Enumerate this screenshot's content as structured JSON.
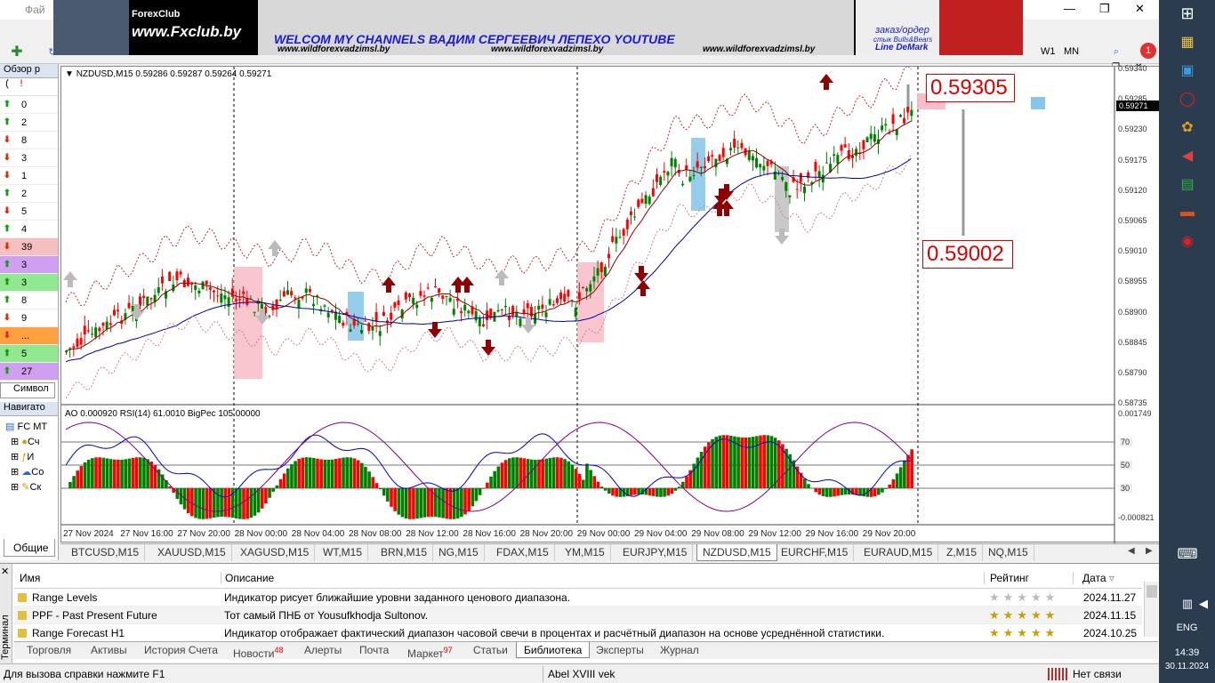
{
  "window": {
    "menu_file": "Фай",
    "controls": [
      "—",
      "❐",
      "✕"
    ],
    "inner_controls": [
      "_",
      "❐",
      "✕"
    ]
  },
  "banner": {
    "site1": "www.Fxclub.by",
    "logo": "ForexClub",
    "headline": "WELCOM MY CHANNELS ВАДИМ СЕРГЕЕВИЧ ЛЕПЕХО YOUTUBE",
    "url_left": "www.wildforexvadzimsl.by",
    "url_center": "www.wildforexvadzimsl.by",
    "url_right": "www.wildforexvadzimsl.by",
    "right_line1": "заказ/ордер",
    "right_line2": "стык Bulls&Bears",
    "right_line3": "Line DeMark"
  },
  "toolbar": {
    "timeframes": [
      "W1",
      "MN"
    ],
    "notification_count": "1"
  },
  "market_watch": {
    "title": "Обзор р",
    "header_icons": [
      "(",
      "!"
    ],
    "rows": [
      {
        "dir": "up",
        "value": "0",
        "bg": "#ffffff"
      },
      {
        "dir": "up",
        "value": "2",
        "bg": "#ffffff"
      },
      {
        "dir": "down",
        "value": "8",
        "bg": "#ffffff"
      },
      {
        "dir": "down",
        "value": "3",
        "bg": "#ffffff"
      },
      {
        "dir": "down",
        "value": "1",
        "bg": "#ffffff"
      },
      {
        "dir": "up",
        "value": "2",
        "bg": "#ffffff"
      },
      {
        "dir": "down",
        "value": "5",
        "bg": "#ffffff"
      },
      {
        "dir": "up",
        "value": "4",
        "bg": "#ffffff"
      },
      {
        "dir": "down",
        "value": "39",
        "bg": "#f4c0c0"
      },
      {
        "dir": "up",
        "value": "3",
        "bg": "#d0a0f0"
      },
      {
        "dir": "up",
        "value": "3",
        "bg": "#90e890"
      },
      {
        "dir": "up",
        "value": "8",
        "bg": "#ffffff"
      },
      {
        "dir": "down",
        "value": "9",
        "bg": "#ffffff"
      },
      {
        "dir": "down",
        "value": "...",
        "bg": "#ffa040"
      },
      {
        "dir": "up",
        "value": "5",
        "bg": "#90e890"
      },
      {
        "dir": "up",
        "value": "27",
        "bg": "#d0a0f0"
      }
    ],
    "tab": "Символ"
  },
  "navigator": {
    "title": "Навигато",
    "items": [
      "FC MT",
      "Сч",
      "И",
      "Со",
      "Ск"
    ],
    "tab": "Общие"
  },
  "chart": {
    "header": "NZDUSD,M15  0.59286 0.59287 0.59264 0.59271",
    "price_levels": [
      "0.59340",
      "0.59285",
      "0.59230",
      "0.59175",
      "0.59120",
      "0.59065",
      "0.59010",
      "0.58955",
      "0.58900",
      "0.58845",
      "0.58790",
      "0.58735"
    ],
    "current_price": "0.59271",
    "level_high": "0.59305",
    "level_low": "0.59002",
    "indicator_header": "AO 0.000920  RSI(14) 61.0010  BigPec 105.00000",
    "indicator_top": "0.001749",
    "indicator_bottom": "-0.000821",
    "rsi_levels": [
      "70",
      "50",
      "30"
    ],
    "time_labels": [
      "27 Nov 2024",
      "27 Nov 16:00",
      "27 Nov 20:00",
      "28 Nov 00:00",
      "28 Nov 04:00",
      "28 Nov 08:00",
      "28 Nov 12:00",
      "28 Nov 16:00",
      "28 Nov 20:00",
      "29 Nov 00:00",
      "29 Nov 04:00",
      "29 Nov 08:00",
      "29 Nov 12:00",
      "29 Nov 16:00",
      "29 Nov 20:00"
    ]
  },
  "chart_tabs": [
    "BTCUSD,M15",
    "XAUUSD,M15",
    "XAGUSD,M15",
    "WT,M15",
    "BRN,M15",
    "NG,M15",
    "FDAX,M15",
    "YM,M15",
    "EURJPY,M15",
    "NZDUSD,M15",
    "EURCHF,M15",
    "EURAUD,M15",
    "Z,M15",
    "NQ,M15"
  ],
  "active_chart_tab": "NZDUSD,M15",
  "terminal": {
    "side_label": "Терминал",
    "columns": {
      "name": "Имя",
      "description": "Описание",
      "rating": "Рейтинг",
      "date": "Дата"
    },
    "rows": [
      {
        "name": "Range Levels",
        "description": "Индикатор рисует ближайшие уровни заданного ценового диапазона.",
        "rating": 0,
        "date": "2024.11.27"
      },
      {
        "name": "PPF - Past Present Future",
        "description": "Тот самый ПНБ от Yousufkhodja Sultonov.",
        "rating": 5,
        "date": "2024.11.15"
      },
      {
        "name": "Range Forecast H1",
        "description": "Индикатор отображает фактический диапазон часовой свечи в процентах и расчётный диапазон на основе усреднённой статистики.",
        "rating": 5,
        "date": "2024.10.25"
      }
    ],
    "tabs": [
      {
        "label": "Торговля",
        "badge": ""
      },
      {
        "label": "Активы",
        "badge": ""
      },
      {
        "label": "История Счета",
        "badge": ""
      },
      {
        "label": "Новости",
        "badge": "48"
      },
      {
        "label": "Алерты",
        "badge": ""
      },
      {
        "label": "Почта",
        "badge": ""
      },
      {
        "label": "Маркет",
        "badge": "97"
      },
      {
        "label": "Статьи",
        "badge": ""
      },
      {
        "label": "Библиотека",
        "badge": ""
      },
      {
        "label": "Эксперты",
        "badge": ""
      },
      {
        "label": "Журнал",
        "badge": ""
      }
    ],
    "active_tab": "Библиотека"
  },
  "statusbar": {
    "help": "Для вызова справки нажмите F1",
    "profile": "Abel XVIII vek",
    "connection": "Нет связи"
  },
  "taskbar": {
    "lang": "ENG",
    "time": "14:39",
    "date": "30.11.2024"
  },
  "colors": {
    "bull": "#008000",
    "bear": "#ff0000",
    "accent_red": "#cc0000",
    "ma_blue": "#0000aa",
    "ma_darkred": "#8b0000"
  }
}
